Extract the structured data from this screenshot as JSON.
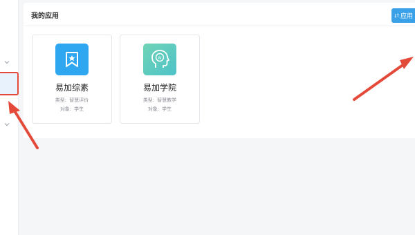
{
  "section": {
    "title": "我的应用"
  },
  "toolbar": {
    "apply_label": "应用",
    "apply_icon": "sort-icon"
  },
  "apps": [
    {
      "name": "易加综素",
      "icon": "bookmark-star-icon",
      "icon_color": "#2ea7f0",
      "type_label": "类型:",
      "type_value": "智慧评价",
      "target_label": "对象:",
      "target_value": "学生"
    },
    {
      "name": "易加学院",
      "icon": "ai-head-icon",
      "icon_color": "#5ccbb0",
      "type_label": "类型:",
      "type_value": "智慧教学",
      "target_label": "对象:",
      "target_value": "学生"
    }
  ],
  "annotations": {
    "arrow_color": "#e34a3a",
    "highlight_color": "#e34a3a"
  }
}
